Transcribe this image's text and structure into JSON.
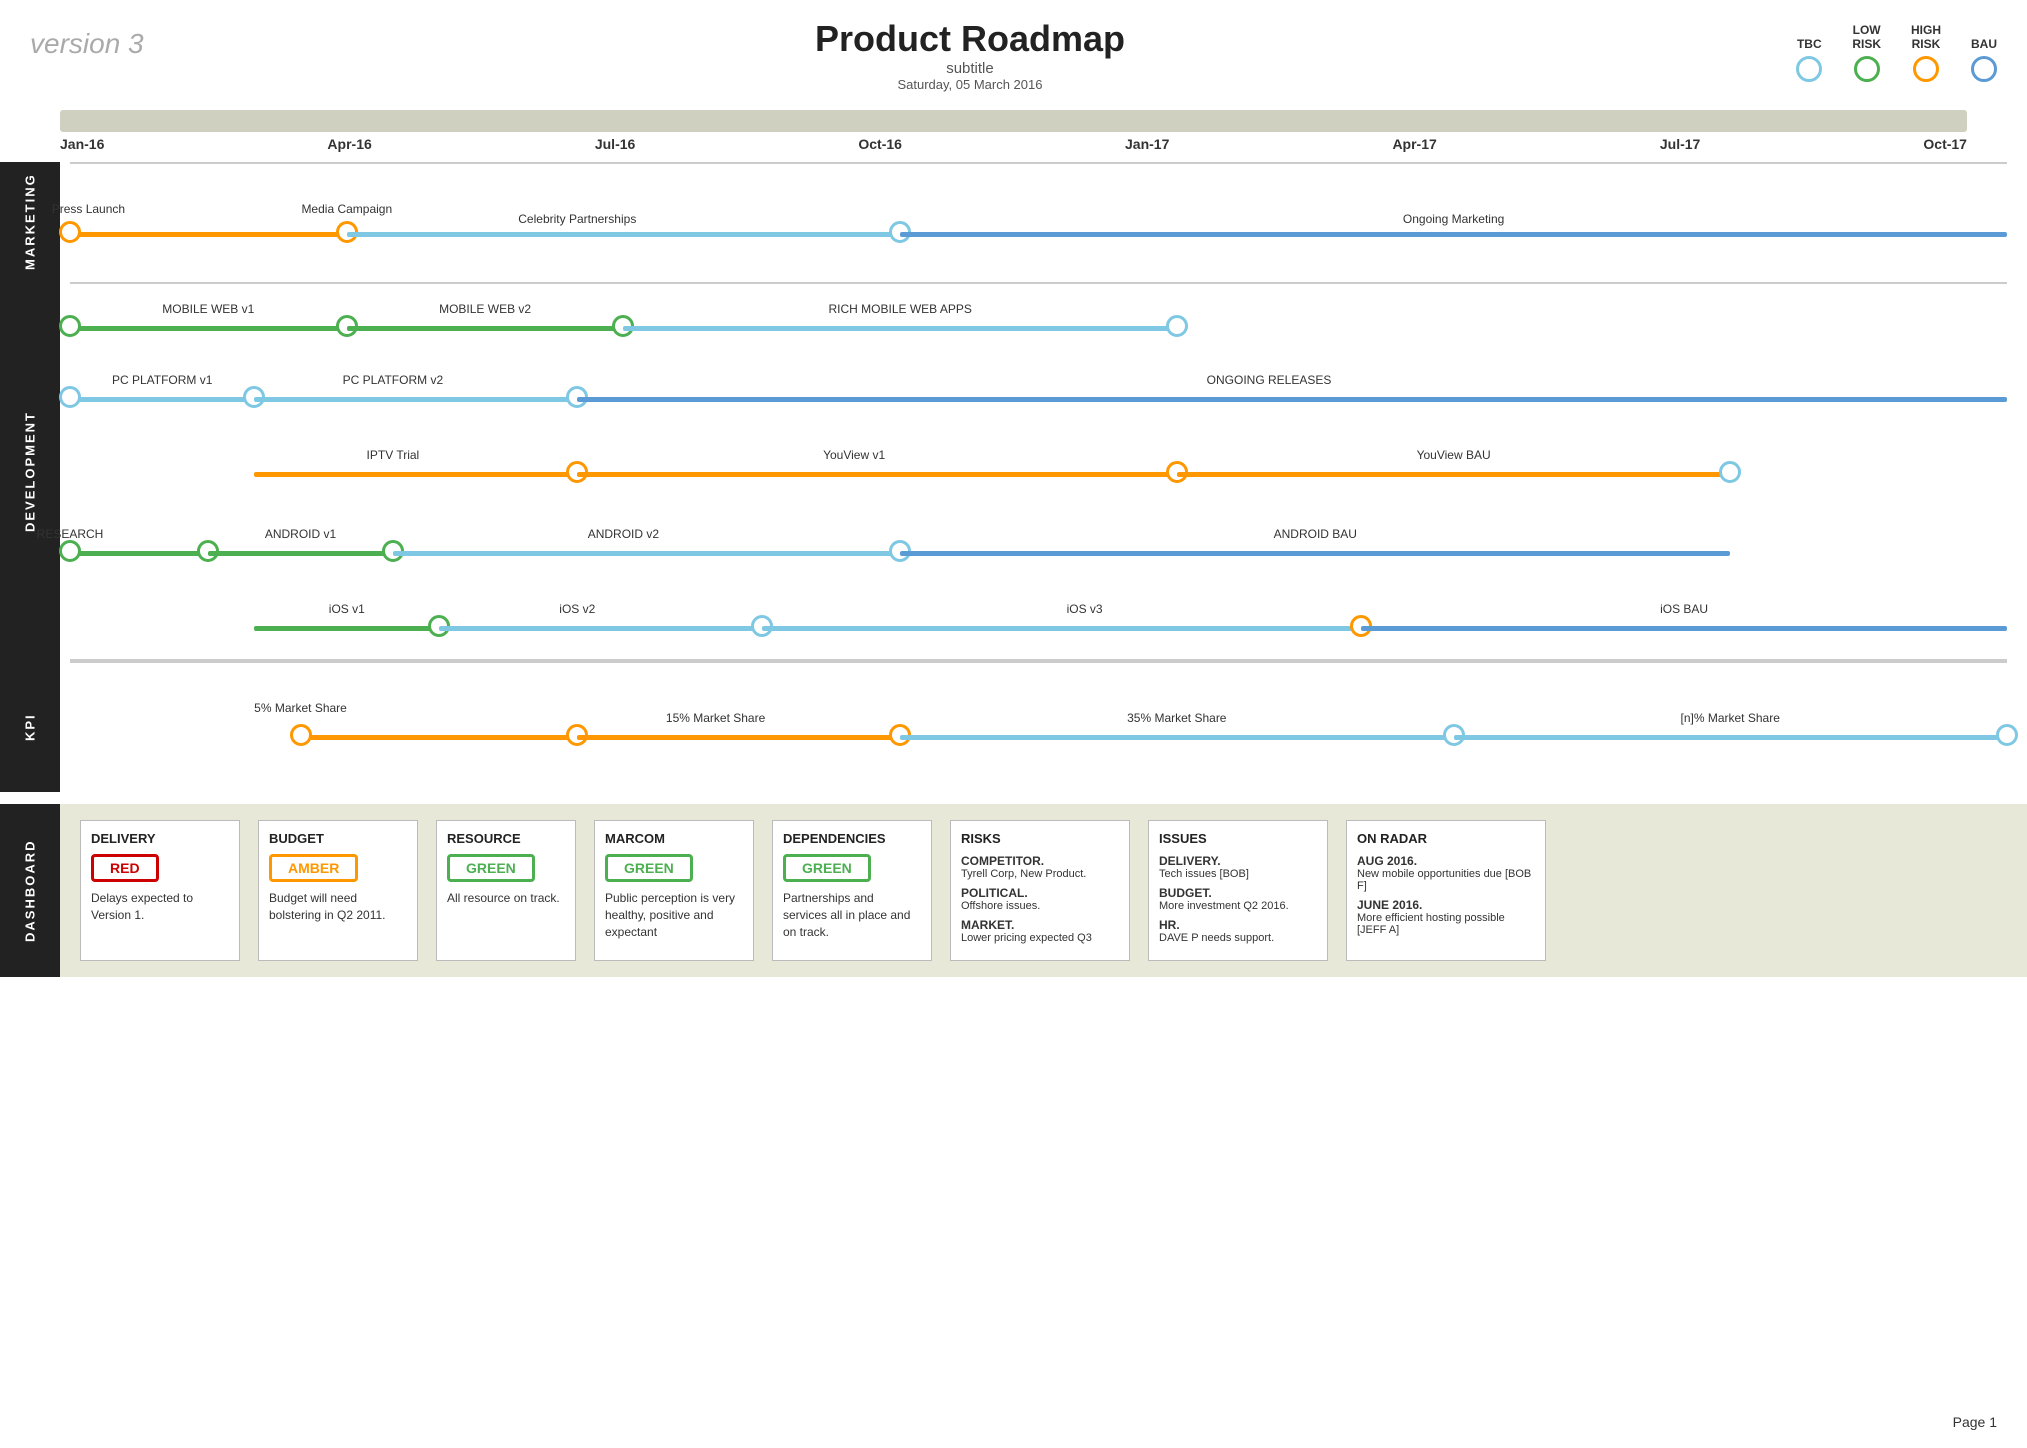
{
  "header": {
    "version": "version 3",
    "title": "Product Roadmap",
    "subtitle": "subtitle",
    "date": "Saturday, 05 March 2016"
  },
  "legend": [
    {
      "id": "tbc",
      "label": "TBC",
      "color_class": "leg-tbc"
    },
    {
      "id": "low-risk",
      "label": "LOW\nRISK",
      "color_class": "leg-low"
    },
    {
      "id": "high-risk",
      "label": "HIGH\nRISK",
      "color_class": "leg-high"
    },
    {
      "id": "bau",
      "label": "BAU",
      "color_class": "leg-bau"
    }
  ],
  "timeline": {
    "labels": [
      "Jan-16",
      "Apr-16",
      "Jul-16",
      "Oct-16",
      "Jan-17",
      "Apr-17",
      "Jul-17",
      "Oct-17"
    ]
  },
  "marketing_items": [
    {
      "label": "Press\nLaunch",
      "label_pos": "above"
    },
    {
      "label": "Media\nCampaign",
      "label_pos": "above"
    },
    {
      "label": "Celebrity Partnerships",
      "label_pos": "above"
    },
    {
      "label": "Ongoing Marketing",
      "label_pos": "above"
    }
  ],
  "development_rows": [
    {
      "items": [
        {
          "label": "MOBILE WEB v1"
        },
        {
          "label": "MOBILE WEB v2"
        },
        {
          "label": "RICH MOBILE WEB APPS"
        }
      ]
    },
    {
      "items": [
        {
          "label": "PC PLATFORM v1"
        },
        {
          "label": "PC PLATFORM v2"
        },
        {
          "label": "ONGOING RELEASES"
        }
      ]
    },
    {
      "items": [
        {
          "label": "IPTV Trial"
        },
        {
          "label": "YouView v1"
        },
        {
          "label": "YouView BAU"
        }
      ]
    },
    {
      "items": [
        {
          "label": "RESEARCH"
        },
        {
          "label": "ANDROID v1"
        },
        {
          "label": "ANDROID v2"
        },
        {
          "label": "ANDROID BAU"
        }
      ]
    },
    {
      "items": [
        {
          "label": "iOS v1"
        },
        {
          "label": "iOS v2"
        },
        {
          "label": "iOS v3"
        },
        {
          "label": "iOS BAU"
        }
      ]
    }
  ],
  "kpi_items": [
    {
      "label": "5% Market\nShare"
    },
    {
      "label": "15% Market Share"
    },
    {
      "label": "35% Market Share"
    },
    {
      "label": "[n]% Market Share"
    }
  ],
  "dashboard": {
    "label": "DASHBOARD",
    "cards": [
      {
        "title": "DELIVERY",
        "badge": "RED",
        "badge_class": "badge-red",
        "text": "Delays expected to Version 1."
      },
      {
        "title": "BUDGET",
        "badge": "AMBER",
        "badge_class": "badge-amber",
        "text": "Budget will need bolstering in Q2 2011."
      },
      {
        "title": "RESOURCE",
        "badge": "GREEN",
        "badge_class": "badge-green",
        "text": "All resource on track."
      },
      {
        "title": "MARCOM",
        "badge": "GREEN",
        "badge_class": "badge-green",
        "text": "Public perception is very healthy, positive and expectant"
      },
      {
        "title": "DEPENDENCIES",
        "badge": "GREEN",
        "badge_class": "badge-green",
        "text": "Partnerships and services all in place and on track."
      },
      {
        "title": "RISKS",
        "wide": true,
        "sections": [
          {
            "subtitle": "COMPETITOR.",
            "text": "Tyrell Corp, New Product."
          },
          {
            "subtitle": "POLITICAL.",
            "text": "Offshore issues."
          },
          {
            "subtitle": "MARKET.",
            "text": "Lower pricing expected Q3"
          }
        ]
      },
      {
        "title": "ISSUES",
        "wide": true,
        "sections": [
          {
            "subtitle": "DELIVERY.",
            "text": "Tech issues [BOB]"
          },
          {
            "subtitle": "BUDGET.",
            "text": "More investment Q2 2016."
          },
          {
            "subtitle": "HR.",
            "text": "DAVE P needs support."
          }
        ]
      },
      {
        "title": "ON RADAR",
        "wide": true,
        "sections": [
          {
            "subtitle": "AUG 2016.",
            "text": "New mobile opportunities due [BOB F]"
          },
          {
            "subtitle": "JUNE 2016.",
            "text": "More efficient hosting possible [JEFF A]"
          }
        ]
      }
    ]
  },
  "page": "Page 1"
}
